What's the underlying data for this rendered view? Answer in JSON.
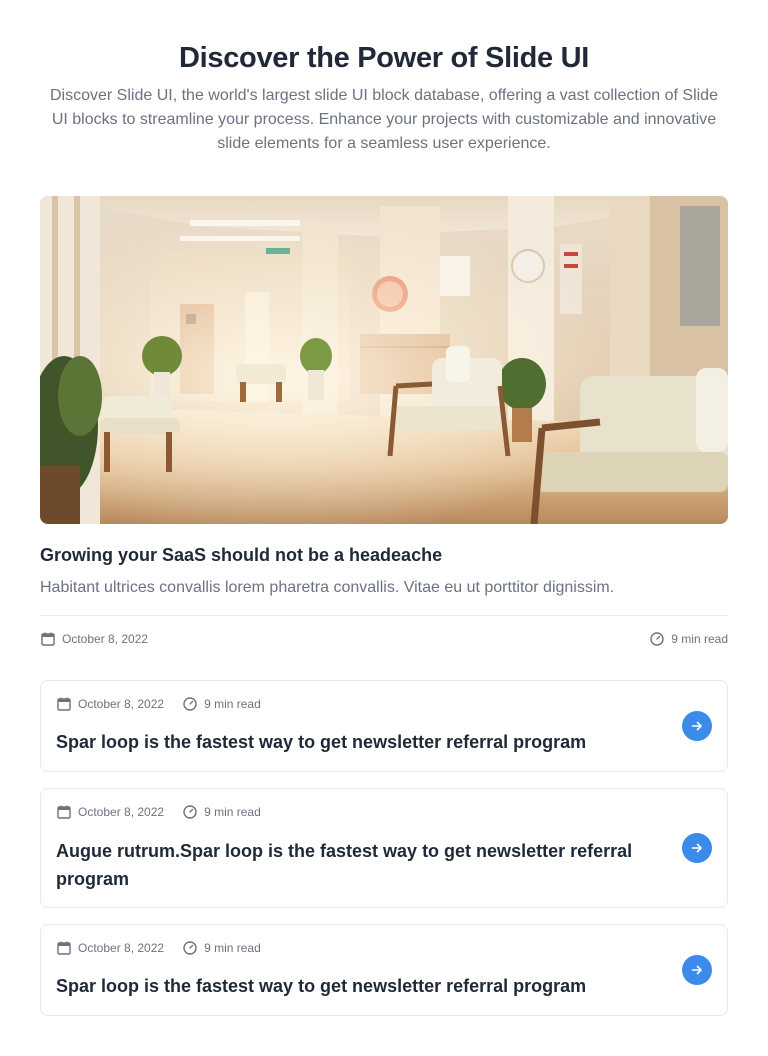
{
  "hero": {
    "title": "Discover the Power of Slide UI",
    "subtitle": "Discover Slide UI, the world's largest slide UI block database, offering a vast collection of Slide UI blocks to streamline your process. Enhance your projects with customizable and innovative slide elements for a seamless user experience."
  },
  "featured": {
    "image_icon": "hospital-waiting-room-photo",
    "title": "Growing your SaaS should not be a headeache",
    "excerpt": "Habitant ultrices convallis lorem pharetra convallis. Vitae eu ut porttitor dignissim.",
    "date": "October 8, 2022",
    "read_time": "9 min read"
  },
  "cards": [
    {
      "date": "October 8, 2022",
      "read_time": "9 min read",
      "title": "Spar loop is the fastest way to get newsletter referral program"
    },
    {
      "date": "October 8, 2022",
      "read_time": "9 min read",
      "title": "Augue rutrum.Spar loop is the fastest way to get newsletter referral program"
    },
    {
      "date": "October 8, 2022",
      "read_time": "9 min read",
      "title": "Spar loop is the fastest way to get newsletter referral program"
    }
  ],
  "icons": {
    "date": "calendar-icon",
    "read_time": "clock-icon",
    "card_action": "arrow-right-icon"
  },
  "colors": {
    "accent": "#3b8beb",
    "heading": "#1f2937",
    "muted": "#6b7280",
    "border": "#e5e7eb"
  }
}
